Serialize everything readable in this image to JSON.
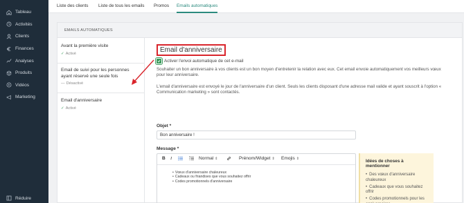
{
  "sidebar": {
    "items": [
      {
        "label": "Tableau",
        "icon": "home-icon"
      },
      {
        "label": "Activités",
        "icon": "activity-icon"
      },
      {
        "label": "Clients",
        "icon": "user-icon"
      },
      {
        "label": "Finances",
        "icon": "euro-icon"
      },
      {
        "label": "Analyses",
        "icon": "chart-icon"
      },
      {
        "label": "Produits",
        "icon": "box-icon"
      },
      {
        "label": "Vidéos",
        "icon": "video-icon"
      },
      {
        "label": "Marketing",
        "icon": "megaphone-icon"
      }
    ],
    "collapse_label": "Réduire"
  },
  "tabs": [
    {
      "label": "Liste des clients",
      "active": false
    },
    {
      "label": "Liste de tous les emails",
      "active": false
    },
    {
      "label": "Promos",
      "active": false
    },
    {
      "label": "Emails automatiques",
      "active": true
    }
  ],
  "card": {
    "header": "EMAILS AUTOMATIQUES",
    "list": [
      {
        "title": "Avant la première visite",
        "status": "Activé",
        "enabled": true
      },
      {
        "title": "Email de suivi pour les personnes ayant réservé une seule fois",
        "status": "Désactivé",
        "enabled": false
      },
      {
        "title": "Email d'anniversaire",
        "status": "Activé",
        "enabled": true
      }
    ],
    "detail": {
      "title": "Email d'anniversaire",
      "toggle_label": "Activer l'envoi automatique de cet e-mail",
      "paragraph_1": "Souhaiter un bon anniversaire à vos clients est un bon moyen d'entretenir la relation avec eux. Cet email envoie automatiquement vos meilleurs vœux pour leur anniversaire.",
      "paragraph_2": "L'email d'anniversaire est envoyé le jour de l'anniversaire d'un client. Seuls les clients disposant d'une adresse mail valide et ayant souscrit à l'option « Communication marketing » sont contactés.",
      "subject_label": "Objet *",
      "subject_value": "Bon anniversaire !",
      "message_label": "Message *",
      "toolbar": {
        "format_label": "Normal",
        "variable_label": "Prénom/Widget",
        "emoji_label": "Emojis"
      },
      "message_lines": [
        "Vœux d'anniversaire chaleureux",
        "Cadeaux ou friandises que vous souhaitez offrir",
        "Codes promotionnels d'anniversaire"
      ],
      "tips": {
        "title": "Idées de choses à mentionner",
        "items": [
          "Des vœux d'anniversaire chaleureux",
          "Cadeaux que vous souhaitez offrir",
          "Codes promotionnels pour les anniversaires"
        ]
      }
    }
  },
  "colors": {
    "sidebar_bg": "#1f2d3a",
    "accent": "#2b8a7e",
    "active_green": "#3a9a5b",
    "highlight_red": "#d9242b",
    "tips_bg": "#fdf5dc"
  }
}
